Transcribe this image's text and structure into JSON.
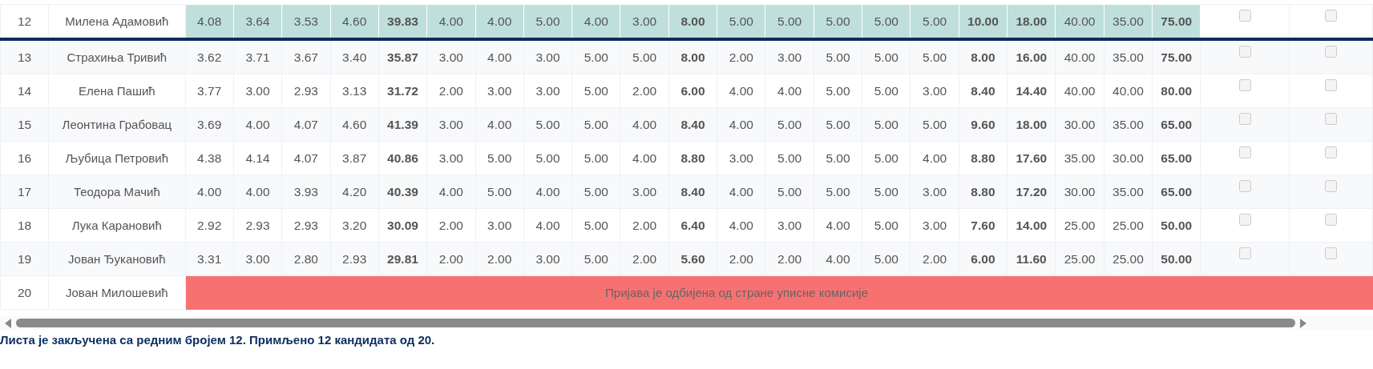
{
  "table": {
    "score_columns": [
      {
        "bold": false
      },
      {
        "bold": false
      },
      {
        "bold": false
      },
      {
        "bold": false
      },
      {
        "bold": true
      },
      {
        "bold": false
      },
      {
        "bold": false
      },
      {
        "bold": false
      },
      {
        "bold": false
      },
      {
        "bold": false
      },
      {
        "bold": true
      },
      {
        "bold": false
      },
      {
        "bold": false
      },
      {
        "bold": false
      },
      {
        "bold": false
      },
      {
        "bold": false
      },
      {
        "bold": true
      },
      {
        "bold": true
      },
      {
        "bold": false
      },
      {
        "bold": false
      },
      {
        "bold": true
      }
    ],
    "rows": [
      {
        "kind": "scored",
        "number": "12",
        "name": "Милена Адамовић",
        "highlighted": true,
        "cutoff": true,
        "scores": [
          "4.08",
          "3.64",
          "3.53",
          "4.60",
          "39.83",
          "4.00",
          "4.00",
          "5.00",
          "4.00",
          "3.00",
          "8.00",
          "5.00",
          "5.00",
          "5.00",
          "5.00",
          "5.00",
          "10.00",
          "18.00",
          "40.00",
          "35.00",
          "75.00"
        ],
        "checks": [
          {
            "checked": false
          },
          {
            "checked": false
          }
        ]
      },
      {
        "kind": "scored",
        "number": "13",
        "name": "Страхиња Тривић",
        "highlighted": false,
        "cutoff": false,
        "scores": [
          "3.62",
          "3.71",
          "3.67",
          "3.40",
          "35.87",
          "3.00",
          "4.00",
          "3.00",
          "5.00",
          "5.00",
          "8.00",
          "2.00",
          "3.00",
          "5.00",
          "5.00",
          "5.00",
          "8.00",
          "16.00",
          "40.00",
          "35.00",
          "75.00"
        ],
        "checks": [
          {
            "checked": false
          },
          {
            "checked": false
          }
        ]
      },
      {
        "kind": "scored",
        "number": "14",
        "name": "Елена Пашић",
        "highlighted": false,
        "cutoff": false,
        "scores": [
          "3.77",
          "3.00",
          "2.93",
          "3.13",
          "31.72",
          "2.00",
          "3.00",
          "3.00",
          "5.00",
          "2.00",
          "6.00",
          "4.00",
          "4.00",
          "5.00",
          "5.00",
          "3.00",
          "8.40",
          "14.40",
          "40.00",
          "40.00",
          "80.00"
        ],
        "checks": [
          {
            "checked": false
          },
          {
            "checked": false
          }
        ]
      },
      {
        "kind": "scored",
        "number": "15",
        "name": "Леонтина Грабовац",
        "highlighted": false,
        "cutoff": false,
        "scores": [
          "3.69",
          "4.00",
          "4.07",
          "4.60",
          "41.39",
          "3.00",
          "4.00",
          "5.00",
          "5.00",
          "4.00",
          "8.40",
          "4.00",
          "5.00",
          "5.00",
          "5.00",
          "5.00",
          "9.60",
          "18.00",
          "30.00",
          "35.00",
          "65.00"
        ],
        "checks": [
          {
            "checked": false
          },
          {
            "checked": false
          }
        ]
      },
      {
        "kind": "scored",
        "number": "16",
        "name": "Љубица Петровић",
        "highlighted": false,
        "cutoff": false,
        "scores": [
          "4.38",
          "4.14",
          "4.07",
          "3.87",
          "40.86",
          "3.00",
          "5.00",
          "5.00",
          "5.00",
          "4.00",
          "8.80",
          "3.00",
          "5.00",
          "5.00",
          "5.00",
          "4.00",
          "8.80",
          "17.60",
          "35.00",
          "30.00",
          "65.00"
        ],
        "checks": [
          {
            "checked": false
          },
          {
            "checked": false
          }
        ]
      },
      {
        "kind": "scored",
        "number": "17",
        "name": "Теодора Мачић",
        "highlighted": false,
        "cutoff": false,
        "scores": [
          "4.00",
          "4.00",
          "3.93",
          "4.20",
          "40.39",
          "4.00",
          "5.00",
          "4.00",
          "5.00",
          "3.00",
          "8.40",
          "4.00",
          "5.00",
          "5.00",
          "5.00",
          "3.00",
          "8.80",
          "17.20",
          "30.00",
          "35.00",
          "65.00"
        ],
        "checks": [
          {
            "checked": false
          },
          {
            "checked": false
          }
        ]
      },
      {
        "kind": "scored",
        "number": "18",
        "name": "Лука Карановић",
        "highlighted": false,
        "cutoff": false,
        "scores": [
          "2.92",
          "2.93",
          "2.93",
          "3.20",
          "30.09",
          "2.00",
          "3.00",
          "4.00",
          "5.00",
          "2.00",
          "6.40",
          "4.00",
          "3.00",
          "4.00",
          "5.00",
          "3.00",
          "7.60",
          "14.00",
          "25.00",
          "25.00",
          "50.00"
        ],
        "checks": [
          {
            "checked": false
          },
          {
            "checked": false
          }
        ]
      },
      {
        "kind": "scored",
        "number": "19",
        "name": "Јован Ђукановић",
        "highlighted": false,
        "cutoff": false,
        "scores": [
          "3.31",
          "3.00",
          "2.80",
          "2.93",
          "29.81",
          "2.00",
          "2.00",
          "3.00",
          "5.00",
          "2.00",
          "5.60",
          "2.00",
          "2.00",
          "4.00",
          "5.00",
          "2.00",
          "6.00",
          "11.60",
          "25.00",
          "25.00",
          "50.00"
        ],
        "checks": [
          {
            "checked": false
          },
          {
            "checked": false
          }
        ]
      },
      {
        "kind": "rejected",
        "number": "20",
        "name": "Јован Милошевић",
        "message": "Пријава је одбијена од стране уписне комисије"
      }
    ]
  },
  "footer": "Листа је закључена са редним бројем 12. Примљено 12 кандидата од 20."
}
